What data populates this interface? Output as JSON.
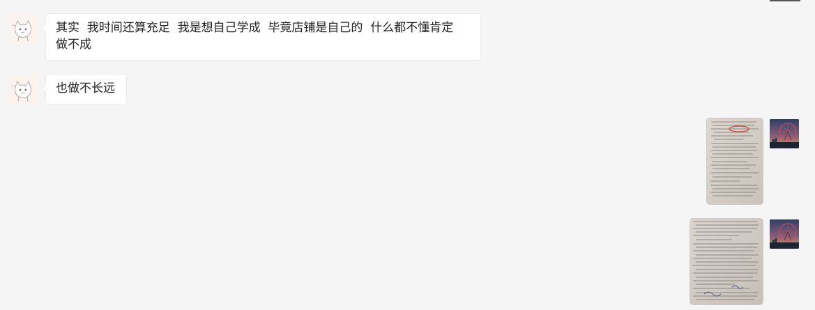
{
  "messages": [
    {
      "sender": "other",
      "text": "其实  我时间还算充足  我是想自己学成  毕竟店铺是自己的  什么都不懂肯定\n做不成"
    },
    {
      "sender": "other",
      "text": "也做不长远"
    },
    {
      "sender": "self",
      "type": "image",
      "content": "photo of printed document page with red circle annotation"
    },
    {
      "sender": "self",
      "type": "image",
      "content": "photo of printed document page with handwriting"
    }
  ],
  "avatars": {
    "other": "cat-avatar",
    "self": "ferris-wheel-sunset-avatar"
  },
  "colors": {
    "background": "#f5f5f5",
    "bubble_other": "#ffffff",
    "text": "#222222",
    "annotation_red": "#d23b3b"
  }
}
